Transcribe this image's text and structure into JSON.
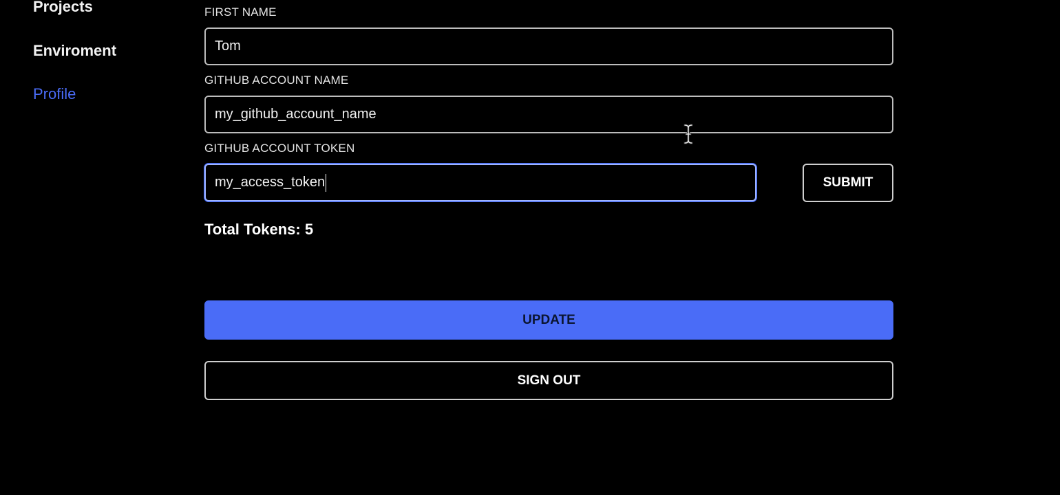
{
  "sidebar": {
    "items": [
      {
        "label": "Projects"
      },
      {
        "label": "Enviroment"
      },
      {
        "label": "Profile",
        "active": true
      }
    ]
  },
  "form": {
    "first_name": {
      "label": "FIRST NAME",
      "value": "Tom"
    },
    "github_account_name": {
      "label": "GITHUB ACCOUNT NAME",
      "value": "my_github_account_name"
    },
    "github_account_token": {
      "label": "GITHUB ACCOUNT TOKEN",
      "value": "my_access_token"
    },
    "submit_label": "SUBMIT",
    "total_tokens": "Total Tokens: 5",
    "update_label": "UPDATE",
    "sign_out_label": "SIGN OUT"
  },
  "colors": {
    "background": "#000000",
    "accent": "#4a6cf7",
    "text": "#ffffff",
    "border": "#bdbdbd"
  },
  "icons": {
    "cursor": "text-cursor-icon"
  }
}
